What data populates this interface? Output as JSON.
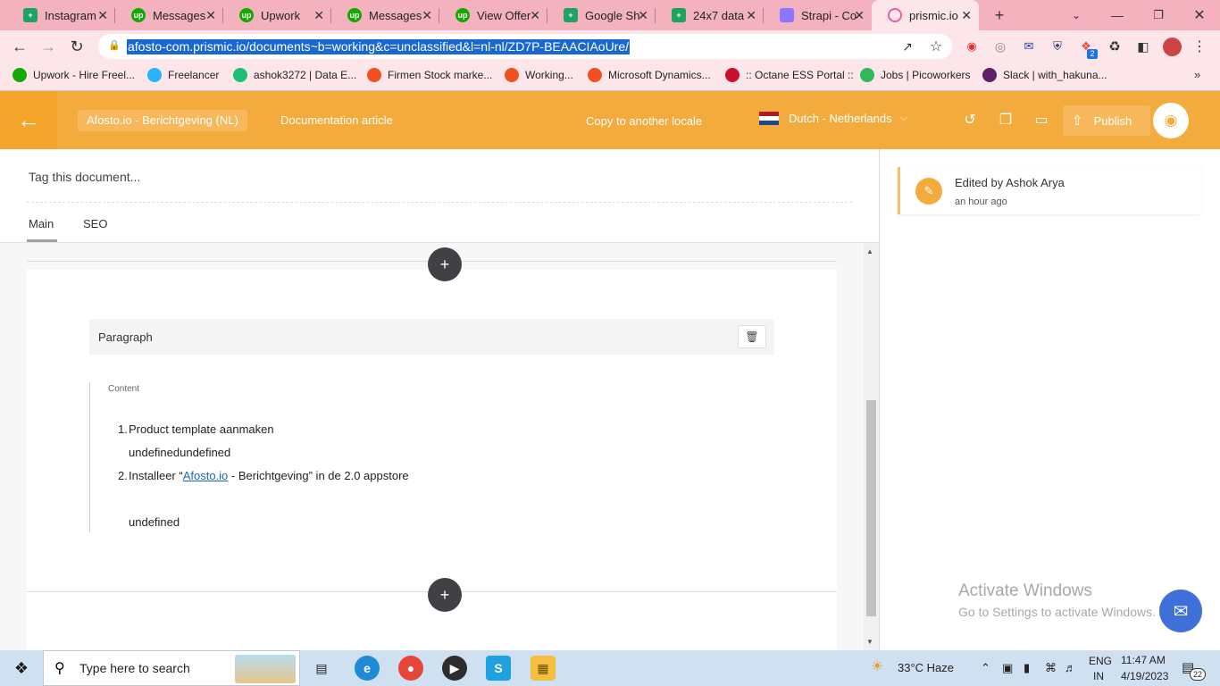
{
  "browser": {
    "tabs": [
      {
        "label": "Instagram",
        "icon": "sheets-icon"
      },
      {
        "label": "Messages",
        "icon": "upwork-icon"
      },
      {
        "label": "Upwork",
        "icon": "upwork-icon"
      },
      {
        "label": "Messages",
        "icon": "upwork-icon"
      },
      {
        "label": "View Offer",
        "icon": "upwork-icon"
      },
      {
        "label": "Google Sh",
        "icon": "sheets-icon"
      },
      {
        "label": "24x7 data",
        "icon": "sheets-icon"
      },
      {
        "label": "Strapi - Co",
        "icon": "strapi-icon"
      },
      {
        "label": "prismic.io",
        "icon": "prismic-icon"
      }
    ],
    "url": "afosto-com.prismic.io/documents~b=working&c=unclassified&l=nl-nl/ZD7P-BEAACIAoUre/",
    "bookmarks": [
      {
        "label": "Upwork - Hire Freel...",
        "color": "#14a800"
      },
      {
        "label": "Freelancer",
        "color": "#29b2fe"
      },
      {
        "label": "ashok3272 | Data E...",
        "color": "#1dbf73"
      },
      {
        "label": "Firmen Stock marke...",
        "color": "#f25022"
      },
      {
        "label": "Working...",
        "color": "#f25022"
      },
      {
        "label": "Microsoft Dynamics...",
        "color": "#f25022"
      },
      {
        "label": ":: Octane ESS Portal ::",
        "color": "#c8102e"
      },
      {
        "label": "Jobs | Picoworkers",
        "color": "#2fb85c"
      },
      {
        "label": "Slack | with_hakuna...",
        "color": "#611f69"
      }
    ],
    "extension_badge": "2"
  },
  "header": {
    "repo": "Afosto.io - Berichtgeving (NL)",
    "doc_type": "Documentation article",
    "copy_locale": "Copy to another locale",
    "locale": "Dutch - Netherlands",
    "publish": "Publish",
    "accent": "#f4ab3d"
  },
  "editor": {
    "tag_placeholder": "Tag this document...",
    "tabs": [
      "Main",
      "SEO"
    ],
    "slice_title": "Paragraph",
    "content_label": "Content",
    "list_item_1": "Product template aanmaken",
    "undefined_line_1": "undefinedundefined",
    "list_item_2_prefix": "Installeer “",
    "list_item_2_link": "Afosto.io",
    "list_item_2_suffix": " - Berichtgeving” in de 2.0 appstore",
    "undefined_line_2": "undefined",
    "num_1": "1.",
    "num_2": "2."
  },
  "history": {
    "edited_by": "Edited by Ashok Arya",
    "when": "an hour ago"
  },
  "watermark": {
    "line1": "Activate Windows",
    "line2": "Go to Settings to activate Windows."
  },
  "taskbar": {
    "search_placeholder": "Type here to search",
    "weather": "33°C  Haze",
    "lang1": "ENG",
    "lang2": "IN",
    "time": "11:47 AM",
    "date": "4/19/2023",
    "notifications": "22"
  }
}
